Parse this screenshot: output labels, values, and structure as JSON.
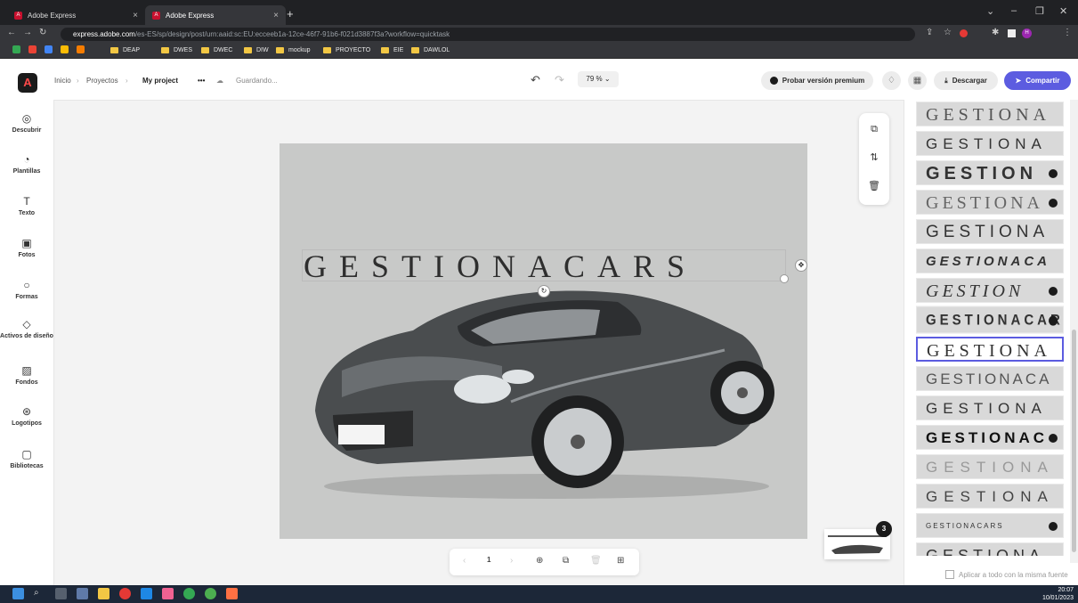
{
  "browser": {
    "tabs": [
      {
        "title": "Adobe Express"
      },
      {
        "title": "Adobe Express"
      }
    ],
    "url": {
      "host": "express.adobe.com",
      "path": "/es-ES/sp/design/post/urn:aaid:sc:EU:ecceeb1a-12ce-46f7-91b6-f021d3887f3a?workflow=quicktask"
    },
    "bookmarks": [
      "DEAP",
      "DWES",
      "DWEC",
      "DIW",
      "mockup",
      "PROYECTO",
      "EIE",
      "DAWLOL"
    ]
  },
  "header": {
    "breadcrumb": {
      "home": "Inicio",
      "projects": "Proyectos",
      "current": "My project"
    },
    "more": "•••",
    "saving": "Guardando...",
    "zoom": "79 %",
    "premium_label": "Probar versión premium",
    "download_label": "Descargar",
    "share_label": "Compartir"
  },
  "sidebar": {
    "items": [
      {
        "label": "Descubrir",
        "icon": "discover-icon"
      },
      {
        "label": "Plantillas",
        "icon": "templates-icon"
      },
      {
        "label": "Texto",
        "icon": "text-icon"
      },
      {
        "label": "Fotos",
        "icon": "photos-icon"
      },
      {
        "label": "Formas",
        "icon": "shapes-icon"
      },
      {
        "label": "Activos de diseño",
        "icon": "design-assets-icon"
      },
      {
        "label": "Fondos",
        "icon": "backgrounds-icon"
      },
      {
        "label": "Logotipos",
        "icon": "logos-icon"
      },
      {
        "label": "Bibliotecas",
        "icon": "libraries-icon"
      }
    ]
  },
  "canvas": {
    "title_text": "GESTIONACARS",
    "background_color": "#c8c9c8",
    "image": "grey sports car"
  },
  "pager": {
    "page": "1",
    "page_count_badge": "3"
  },
  "font_panel": {
    "fonts": [
      {
        "sample": "GESTIONA"
      },
      {
        "sample": "GESTIONA"
      },
      {
        "sample": "GESTION"
      },
      {
        "sample": "GESTIONA"
      },
      {
        "sample": "GESTIONA"
      },
      {
        "sample": "GESTIONACA"
      },
      {
        "sample": "GESTION"
      },
      {
        "sample": "GESTIONACAR"
      },
      {
        "sample": "GESTIONA",
        "selected": true
      },
      {
        "sample": "GESTIONACA"
      },
      {
        "sample": "GESTIONA"
      },
      {
        "sample": "GESTIONAC"
      },
      {
        "sample": "GESTIONA"
      },
      {
        "sample": "GESTIONA"
      },
      {
        "sample": "GESTIONACARS"
      },
      {
        "sample": "GESTIONA"
      }
    ],
    "apply_all_label": "Aplicar a todo con la misma fuente"
  },
  "taskbar": {
    "time": "20:07",
    "date": "10/01/2023"
  },
  "colors": {
    "accent": "#5c5ce0",
    "logo": "#ff4a4a"
  }
}
